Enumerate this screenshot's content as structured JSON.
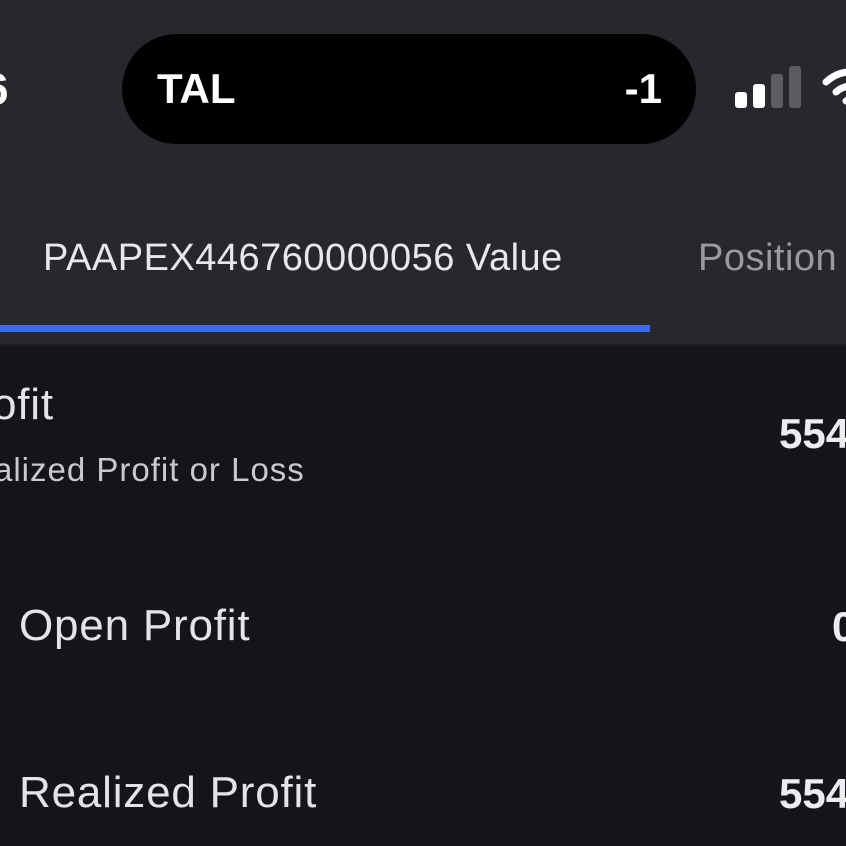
{
  "status_bar": {
    "time_fragment": "6",
    "island": {
      "left_text": "TAL",
      "right_text": "-1"
    }
  },
  "tabs": [
    {
      "label": "PAAPEX446760000056 Value",
      "active": true
    },
    {
      "label": "Position",
      "active": false
    }
  ],
  "colors": {
    "accent": "#3a6ee8",
    "header_bg": "#28272e",
    "content_bg": "#15141a"
  },
  "rows": {
    "profit": {
      "label": "ofit",
      "sublabel": "alized Profit or Loss",
      "value": "554"
    },
    "open_profit": {
      "label": "Open Profit",
      "value": "0"
    },
    "realized_profit": {
      "label": "Realized Profit",
      "value": "554"
    }
  }
}
